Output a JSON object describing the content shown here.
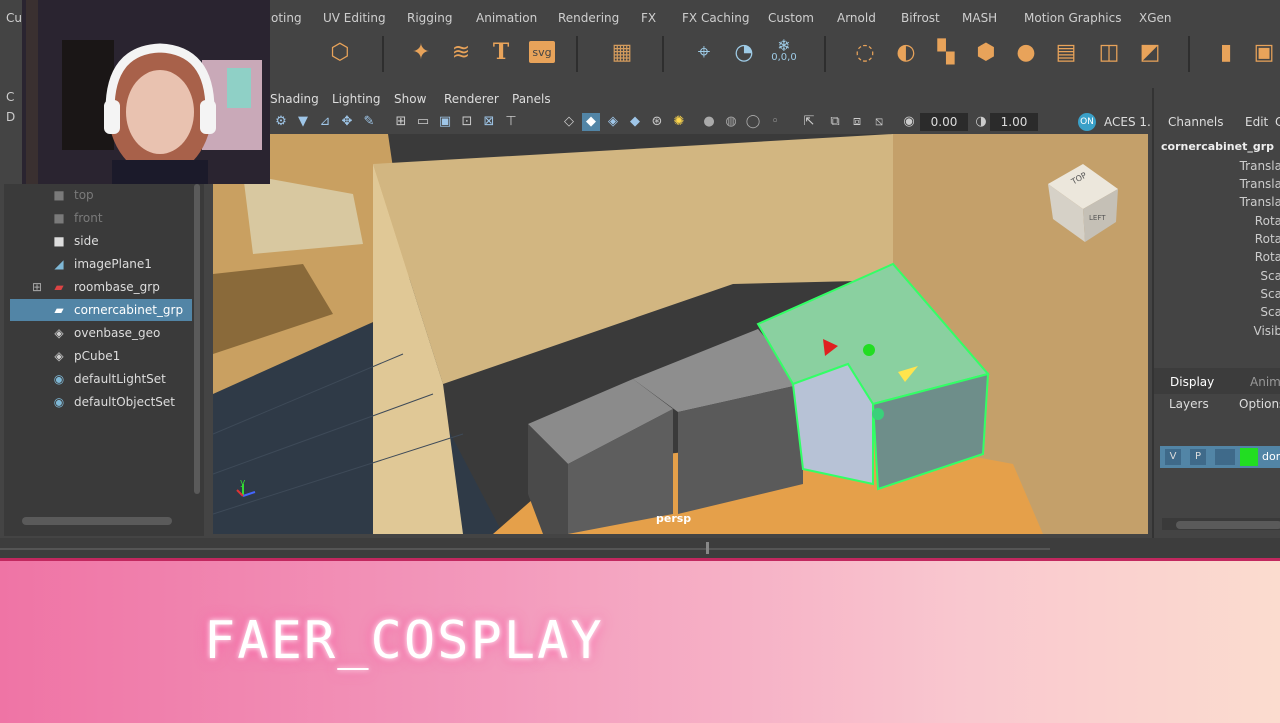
{
  "shelf_tabs": [
    "Cu",
    "oting",
    "UV Editing",
    "Rigging",
    "Animation",
    "Rendering",
    "FX",
    "FX Caching",
    "Custom",
    "Arnold",
    "Bifrost",
    "MASH",
    "Motion Graphics",
    "XGen"
  ],
  "shelf_icon_labels": {
    "text_tool": "T",
    "svg_tool": "svg",
    "snow_value": "0,0,0"
  },
  "viewport_menu": [
    "Shading",
    "Lighting",
    "Show",
    "Renderer",
    "Panels"
  ],
  "viewport_fields": {
    "exposure": "0.00",
    "gamma": "1.00",
    "colorspace": "ACES 1."
  },
  "viewport_camera_label": "persp",
  "viewcube_labels": {
    "top": "TOP",
    "left": "LEFT"
  },
  "axis_labels": {
    "y": "y",
    "x": "x"
  },
  "outliner": {
    "left_letters": [
      "C",
      "D"
    ],
    "items": [
      {
        "label": "top",
        "icon": "camera-icon",
        "dim": true
      },
      {
        "label": "front",
        "icon": "camera-icon",
        "dim": true
      },
      {
        "label": "side",
        "icon": "camera-icon",
        "dim": false
      },
      {
        "label": "imagePlane1",
        "icon": "image-plane-icon",
        "dim": false
      },
      {
        "label": "roombase_grp",
        "icon": "group-icon",
        "dim": false,
        "expandable": true
      },
      {
        "label": "cornercabinet_grp",
        "icon": "group-icon",
        "dim": false,
        "selected": true
      },
      {
        "label": "ovenbase_geo",
        "icon": "mesh-icon",
        "dim": false
      },
      {
        "label": "pCube1",
        "icon": "mesh-icon",
        "dim": false
      },
      {
        "label": "defaultLightSet",
        "icon": "set-icon",
        "dim": false
      },
      {
        "label": "defaultObjectSet",
        "icon": "set-icon",
        "dim": false
      }
    ]
  },
  "channel_box": {
    "menu": [
      "Channels",
      "Edit",
      "C"
    ],
    "object_name": "cornercabinet_grp",
    "attributes": [
      "Transla",
      "Transla",
      "Transla",
      "Rota",
      "Rota",
      "Rota",
      "Sca",
      "Sca",
      "Sca",
      "Visib"
    ],
    "tabs": [
      "Display",
      "Anim"
    ],
    "subtabs": [
      "Layers",
      "Options"
    ],
    "layer": {
      "v": "V",
      "p": "P",
      "name": "don",
      "color": "#22dd22"
    }
  },
  "banner": {
    "text": "FAER_COSPLAY"
  },
  "colors": {
    "accent": "#5285a6",
    "banner_border": "#c2285f",
    "selection_green": "#33ff66"
  }
}
